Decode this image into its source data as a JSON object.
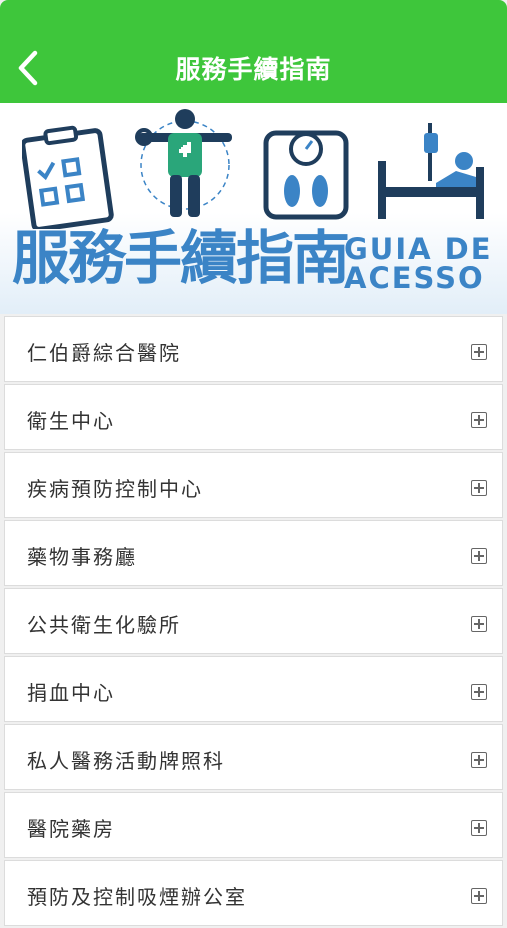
{
  "header": {
    "title": "服務手續指南",
    "back_icon": "chevron-left-icon"
  },
  "banner": {
    "title": "服務手續指南",
    "subtitle_line1": "GUIA DE",
    "subtitle_line2": "ACESSO",
    "icons": [
      "checklist-icon",
      "first-aid-person-icon",
      "weight-scale-icon",
      "hospital-bed-icon"
    ]
  },
  "items": [
    {
      "label": "仁伯爵綜合醫院"
    },
    {
      "label": "衛生中心"
    },
    {
      "label": "疾病預防控制中心"
    },
    {
      "label": "藥物事務廳"
    },
    {
      "label": "公共衛生化驗所"
    },
    {
      "label": "捐血中心"
    },
    {
      "label": "私人醫務活動牌照科"
    },
    {
      "label": "醫院藥房"
    },
    {
      "label": "預防及控制吸煙辦公室"
    }
  ],
  "colors": {
    "header": "#3ec63b",
    "banner_text": "#3b84c6",
    "icon_dark": "#1f3d5c",
    "icon_blue": "#3b84c6"
  }
}
